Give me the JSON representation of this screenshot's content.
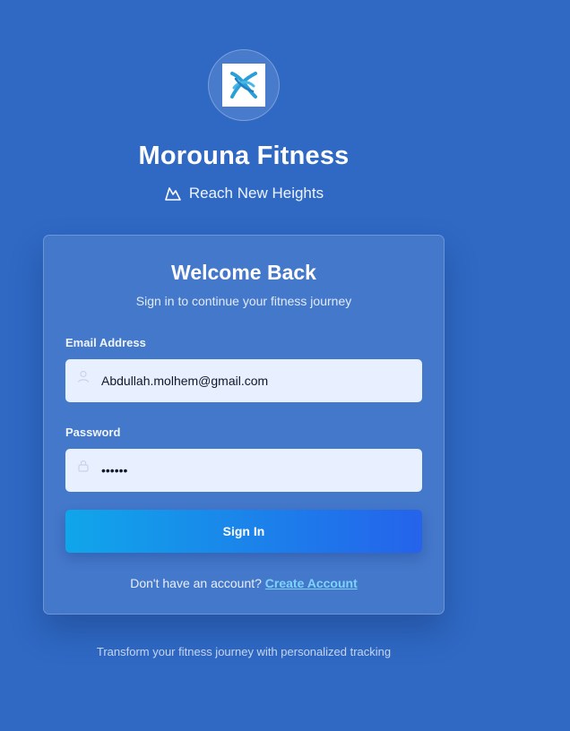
{
  "brand": {
    "name": "Morouna Fitness",
    "tagline": "Reach New Heights",
    "logo_icon": "ribbon-logo-icon",
    "tagline_icon": "mountain-icon"
  },
  "card": {
    "title": "Welcome Back",
    "subtitle": "Sign in to continue your fitness journey",
    "email": {
      "label": "Email Address",
      "value": "Abdullah.molhem@gmail.com",
      "icon": "user-icon"
    },
    "password": {
      "label": "Password",
      "value": "123456",
      "icon": "lock-icon"
    },
    "submit_label": "Sign In",
    "no_account_text": "Don't have an account?",
    "create_account_label": "Create Account"
  },
  "footer": {
    "note": "Transform your fitness journey with personalized tracking"
  },
  "colors": {
    "background": "#2f69c4",
    "button_start": "#10a6ea",
    "button_end": "#2563eb",
    "link": "#7dd3fc",
    "input_bg": "#e8efff"
  }
}
